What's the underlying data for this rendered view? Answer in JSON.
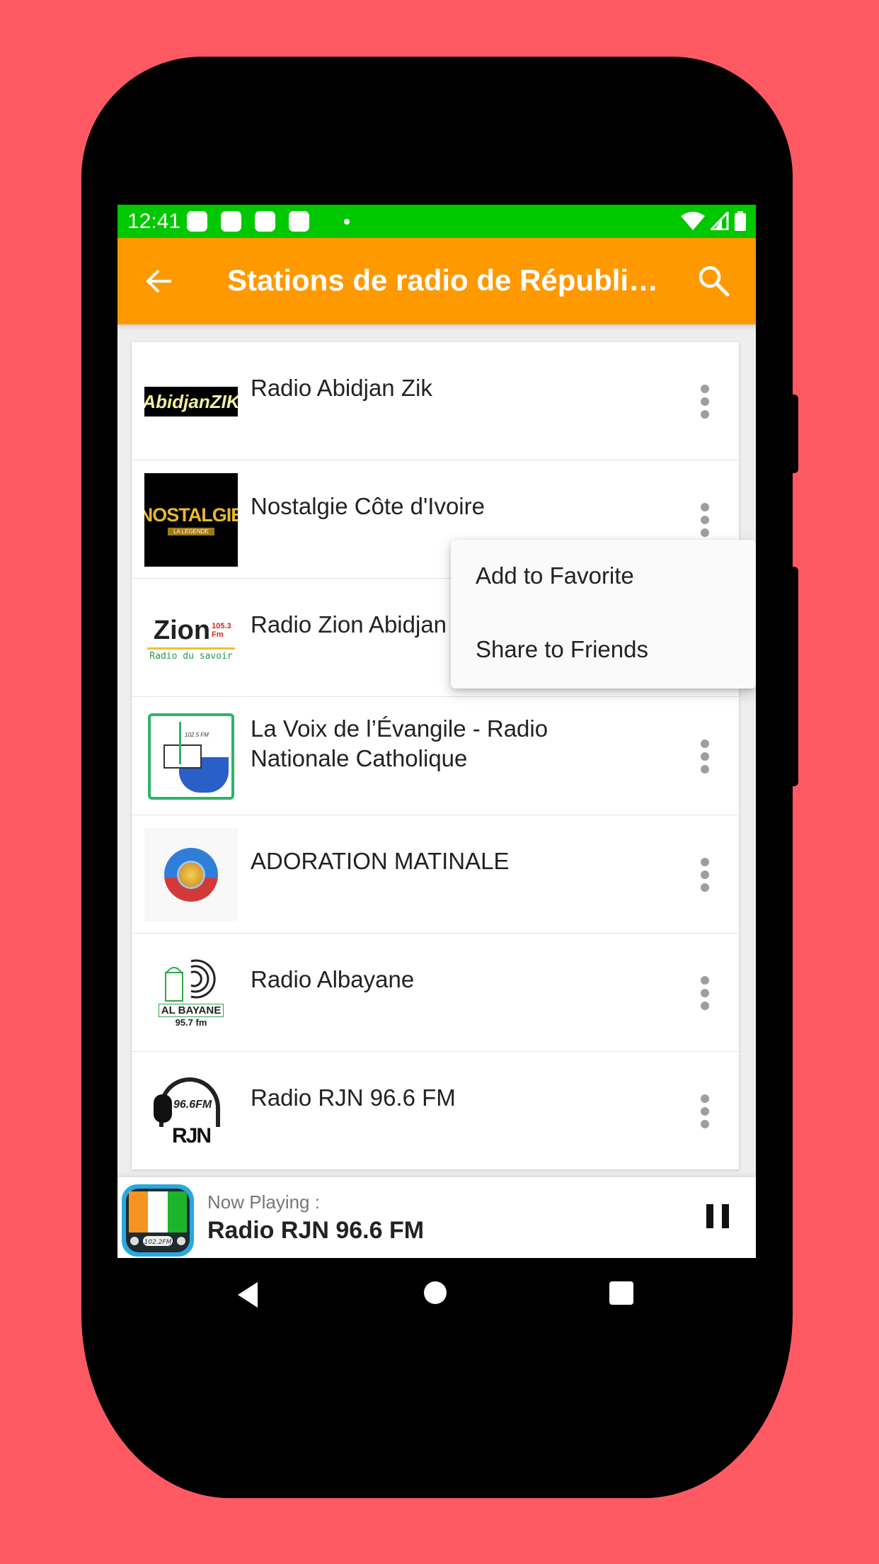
{
  "status_bar": {
    "time": "12:41",
    "notification_icons": [
      "app-notification-icon",
      "app-notification-icon",
      "app-notification-icon",
      "app-notification-icon"
    ],
    "system_icons": [
      "wifi-icon",
      "signal-icon",
      "battery-icon"
    ]
  },
  "app_bar": {
    "title": "Stations de radio de Républi…",
    "back_icon": "arrow-left-icon",
    "search_icon": "search-icon"
  },
  "stations": [
    {
      "name": "Radio Abidjan Zik",
      "logo": "abidjan-zik-logo",
      "logo_text": "AbidjanZIK"
    },
    {
      "name": "Nostalgie Côte d'Ivoire",
      "logo": "nostalgie-logo",
      "logo_text": "NOSTALGIE",
      "logo_subtext": "LA LEGENDE"
    },
    {
      "name": "Radio Zion Abidjan",
      "logo": "zion-logo",
      "logo_text": "Zion",
      "logo_freq": "105.3 Fm",
      "logo_subtext": "Radio du savoir"
    },
    {
      "name": "La Voix de l’Évangile - Radio Nationale Catholique",
      "logo": "voix-evangile-logo",
      "logo_freq": "102.5 FM"
    },
    {
      "name": "ADORATION MATINALE",
      "logo": "adoration-matinale-logo"
    },
    {
      "name": "Radio Albayane",
      "logo": "albayane-logo",
      "logo_text": "AL BAYANE",
      "logo_freq": "95.7 fm"
    },
    {
      "name": "Radio RJN 96.6 FM",
      "logo": "rjn-logo",
      "logo_text": "RJN",
      "logo_freq": "96.6FM"
    }
  ],
  "context_menu": {
    "items": [
      "Add to Favorite",
      "Share to Friends"
    ]
  },
  "now_playing": {
    "label": "Now Playing :",
    "station": "Radio RJN 96.6 FM",
    "icon_freq": "102.2FM",
    "state": "playing"
  },
  "colors": {
    "background": "#FF5A64",
    "status_bar": "#00C800",
    "app_bar": "#FF9900",
    "list_bg": "#EEEEEE"
  }
}
